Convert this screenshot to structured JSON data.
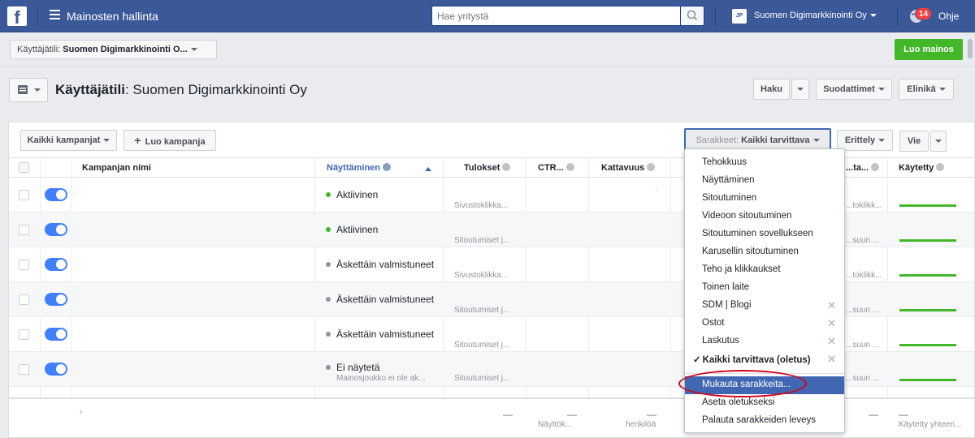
{
  "topbar": {
    "logo": "f",
    "app_title": "Mainosten hallinta",
    "search_placeholder": "Hae yritystä",
    "account_chip": "JP",
    "account_name": "Suomen Digimarkkinointi Oy",
    "notification_count": "14",
    "help_label": "Ohje",
    "colors": {
      "bar": "#3b5998",
      "badge": "#fa3e3e"
    },
    "icons": [
      "facebook-logo-icon",
      "hamburger-icon",
      "search-icon",
      "notification-globe-icon"
    ]
  },
  "subbar": {
    "account_label": "Käyttäjätili:",
    "account_value": "Suomen Digimarkkinointi O...",
    "create_ad_label": "Luo mainos",
    "create_ad_color": "#42b72a"
  },
  "header": {
    "title_label": "Käyttäjätili",
    "title_value": ": Suomen Digimarkkinointi Oy",
    "search_btn": "Haku",
    "filters_btn": "Suodattimet",
    "lifetime_btn": "Elinikä"
  },
  "toolbar": {
    "campaigns_btn": "Kaikki kampanjat",
    "create_campaign_btn": "Luo kampanja",
    "columns_label": "Sarakkeet:",
    "columns_value": "Kaikki tarvittava",
    "breakdown_btn": "Erittely",
    "export_btn": "Vie"
  },
  "table": {
    "headers": {
      "name": "Kampanjan nimi",
      "delivery": "Näyttäminen",
      "results": "Tulokset",
      "ctr": "CTR...",
      "reach": "Kattavuus",
      "cost": "...ta...",
      "spent": "Käytetty"
    },
    "rows": [
      {
        "status": "Aktiivinen",
        "status_sub": "",
        "status_color": "#42b72a",
        "result": "Sivustoklikka...",
        "result2": "...toklikk..."
      },
      {
        "status": "Aktiivinen",
        "status_sub": "",
        "status_color": "#42b72a",
        "result": "Sitoutumiset j...",
        "result2": "...suun ..."
      },
      {
        "status": "Äskettäin valmistuneet",
        "status_sub": "",
        "status_color": "#90949c",
        "result": "Sivustoklikka...",
        "result2": "...toklikk..."
      },
      {
        "status": "Äskettäin valmistuneet",
        "status_sub": "",
        "status_color": "#90949c",
        "result": "Sitoutumiset j...",
        "result2": "...suun ..."
      },
      {
        "status": "Äskettäin valmistuneet",
        "status_sub": "",
        "status_color": "#90949c",
        "result": "Sitoutumiset j...",
        "result2": "...suun ..."
      },
      {
        "status": "Ei näytetä",
        "status_sub": "Mainosjoukko ei ole ak...",
        "status_color": "#90949c",
        "result": "Sitoutumiset j...",
        "result2": "...suun ..."
      }
    ],
    "summary": {
      "results": "—",
      "ctr": "—",
      "ctr_sub": "Näyttök...",
      "reach": "—",
      "reach_sub": "henkilöä",
      "cost": "—",
      "spent": "—",
      "spent_sub": "Käytetty yhteen..."
    }
  },
  "dropdown": {
    "items": [
      {
        "label": "Tehokkuus",
        "removable": false
      },
      {
        "label": "Näyttäminen",
        "removable": false
      },
      {
        "label": "Sitoutuminen",
        "removable": false
      },
      {
        "label": "Videoon sitoutuminen",
        "removable": false
      },
      {
        "label": "Sitoutuminen sovellukseen",
        "removable": false
      },
      {
        "label": "Karusellin sitoutuminen",
        "removable": false
      },
      {
        "label": "Teho ja klikkaukset",
        "removable": false
      },
      {
        "label": "Toinen laite",
        "removable": false
      },
      {
        "label": "SDM | Blogi",
        "removable": true
      },
      {
        "label": "Ostot",
        "removable": true
      },
      {
        "label": "Laskutus",
        "removable": true
      },
      {
        "label": "Kaikki tarvittava (oletus)",
        "removable": true,
        "selected": true
      }
    ],
    "actions": [
      {
        "label": "Mukauta sarakkeita...",
        "highlighted": true
      },
      {
        "label": "Aseta oletukseksi"
      },
      {
        "label": "Palauta sarakkeiden leveys"
      }
    ],
    "check": "✓",
    "remove": "✕"
  }
}
